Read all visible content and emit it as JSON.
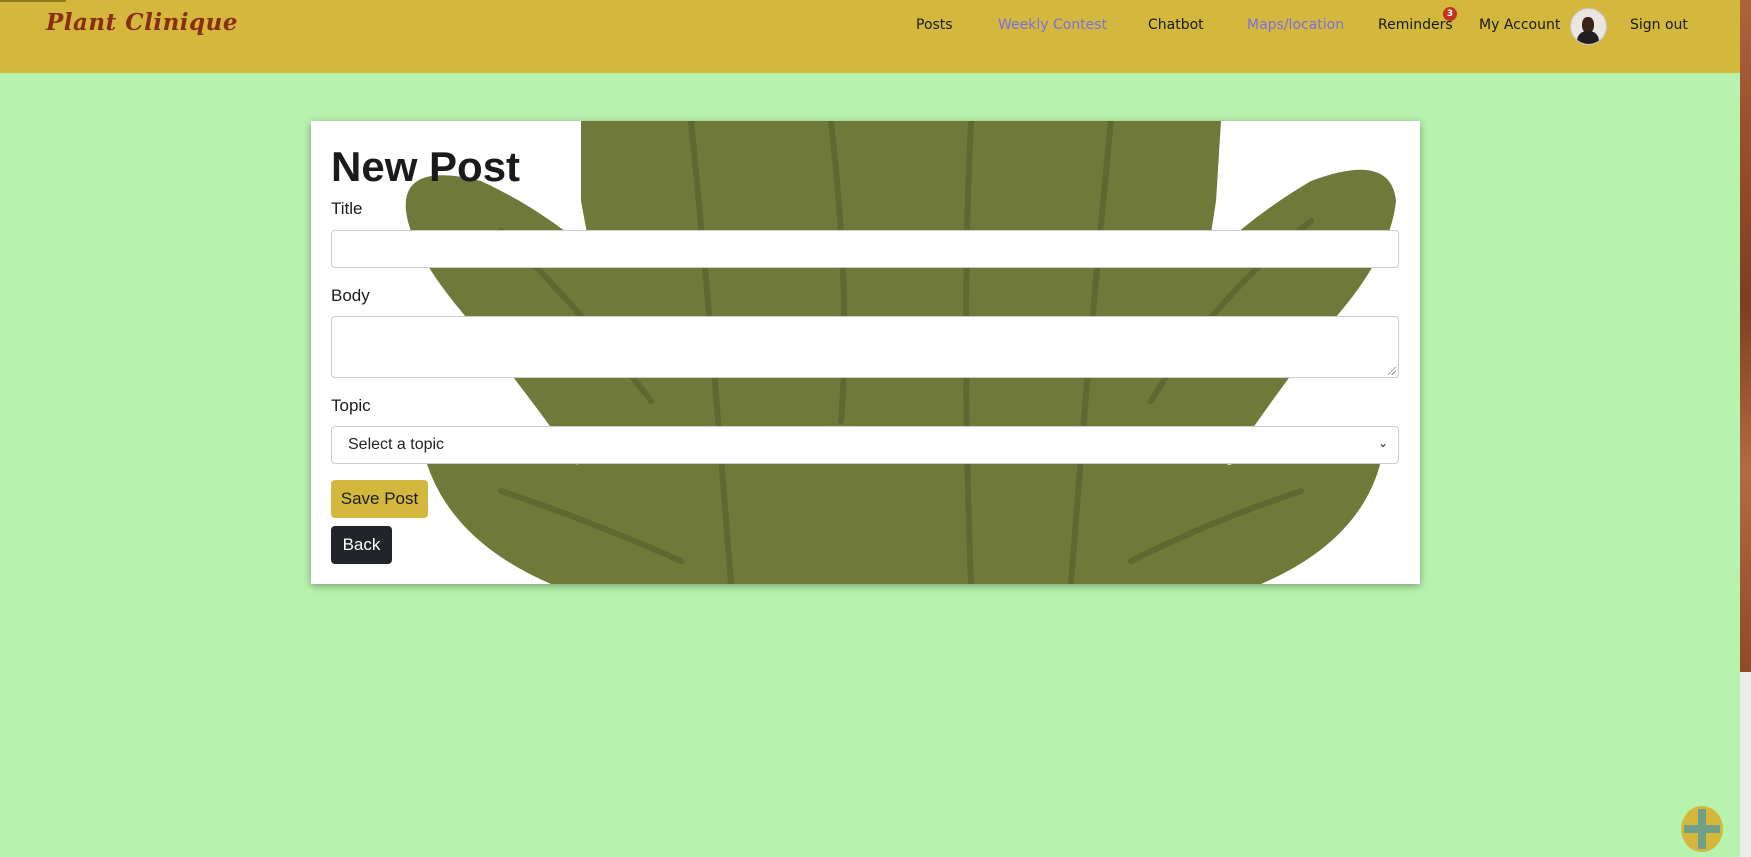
{
  "navbar": {
    "brand": "Plant Clinique",
    "links": {
      "posts": "Posts",
      "weekly_contest": "Weekly Contest",
      "chatbot": "Chatbot",
      "maps": "Maps/location",
      "reminders": "Reminders",
      "my_account": "My Account",
      "sign_out": "Sign out"
    },
    "reminders_badge": "3"
  },
  "form": {
    "heading": "New Post",
    "title_label": "Title",
    "title_value": "",
    "body_label": "Body",
    "body_value": "",
    "topic_label": "Topic",
    "topic_selected": "Select a topic",
    "save_label": "Save Post",
    "back_label": "Back"
  },
  "colors": {
    "page_background": "#b8f3ad",
    "navbar": "#d3b83d",
    "save_button": "#d3b83d",
    "back_button": "#212529"
  },
  "icons": {
    "fab": "plus-icon",
    "avatar": "user-avatar"
  }
}
